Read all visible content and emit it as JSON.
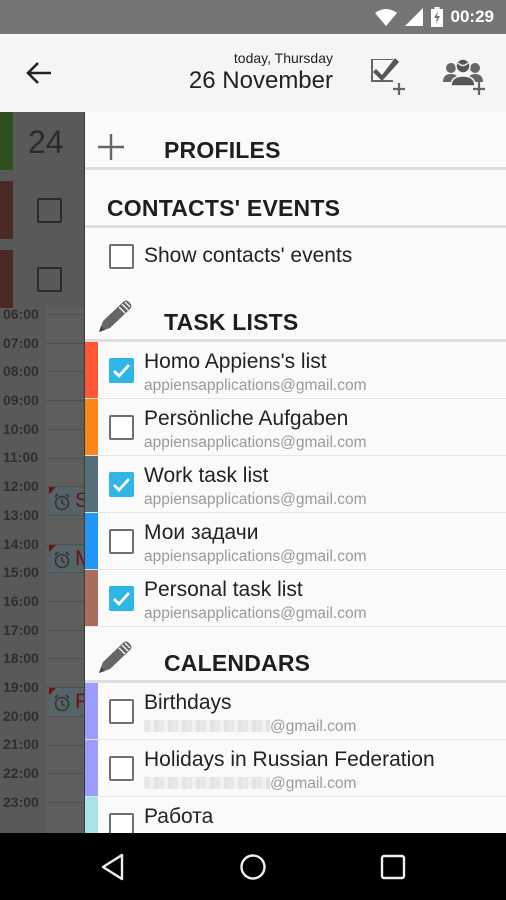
{
  "status_bar": {
    "time": "00:29",
    "icons": [
      "wifi-icon",
      "cell-signal-icon",
      "battery-charging-icon"
    ]
  },
  "app_bar": {
    "back_icon": "arrow-back-icon",
    "date_subtitle": "today, Thursday",
    "date_title": "26 November",
    "actions": [
      {
        "name": "add-task-list",
        "icon": "checkbox-plus-icon"
      },
      {
        "name": "add-profile",
        "icon": "people-plus-icon"
      }
    ]
  },
  "background_calendar": {
    "day_number": "24",
    "hours": [
      "06:00",
      "07:00",
      "08:00",
      "09:00",
      "10:00",
      "11:00",
      "12:00",
      "13:00",
      "14:00",
      "15:00",
      "16:00",
      "17:00",
      "18:00",
      "19:00",
      "20:00",
      "21:00",
      "22:00",
      "23:00"
    ],
    "events": [
      {
        "letter": "S",
        "hour": "12:00"
      },
      {
        "letter": "M",
        "hour": "14:00"
      },
      {
        "letter": "P",
        "hour": "19:00"
      }
    ]
  },
  "drawer": {
    "profiles": {
      "title": "PROFILES",
      "icon": "plus-icon"
    },
    "contacts_events": {
      "title": "CONTACTS' EVENTS",
      "show_label": "Show contacts' events",
      "checked": false
    },
    "task_lists": {
      "title": "TASK LISTS",
      "icon": "pencil-icon",
      "items": [
        {
          "name": "Homo Appiens's list",
          "account": "appiensapplications@gmail.com",
          "checked": true,
          "color": "#ff5636"
        },
        {
          "name": "Persönliche Aufgaben",
          "account": "appiensapplications@gmail.com",
          "checked": false,
          "color": "#f7861b"
        },
        {
          "name": "Work task list",
          "account": "appiensapplications@gmail.com",
          "checked": true,
          "color": "#546e7a"
        },
        {
          "name": "Мои задачи",
          "account": "appiensapplications@gmail.com",
          "checked": false,
          "color": "#2196f3"
        },
        {
          "name": "Personal task list",
          "account": "appiensapplications@gmail.com",
          "checked": true,
          "color": "#a86d5c"
        }
      ]
    },
    "calendars": {
      "title": "CALENDARS",
      "icon": "pencil-icon",
      "items": [
        {
          "name": "Birthdays",
          "account_suffix": "@gmail.com",
          "checked": false,
          "color": "#9c9cff"
        },
        {
          "name": "Holidays in Russian Federation",
          "account_suffix": "@gmail.com",
          "checked": false,
          "color": "#9c9cff"
        },
        {
          "name": "Работа",
          "account_suffix": "",
          "checked": false,
          "color": "#a6e3e8"
        }
      ]
    }
  },
  "nav_bar": {
    "buttons": [
      "back-triangle-icon",
      "home-circle-icon",
      "recents-square-icon"
    ]
  }
}
